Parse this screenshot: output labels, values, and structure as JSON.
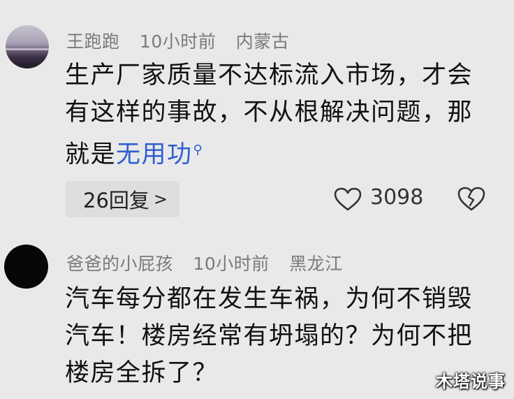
{
  "comments": [
    {
      "username": "王跑跑",
      "time": "10小时前",
      "location": "内蒙古",
      "text_main": "生产厂家质量不达标流入市场，才会有这样的事故，不从根解决问题，那就是",
      "text_link": "无用功",
      "replies_label": "26回复",
      "likes": "3098"
    },
    {
      "username": "爸爸的小屁孩",
      "time": "10小时前",
      "location": "黑龙江",
      "text_main": "汽车每分都在发生车祸，为何不销毁汽车！楼房经常有坍塌的？为何不把楼房全拆了？"
    }
  ],
  "watermark": "木塔说事",
  "icons": {
    "search": "search-icon",
    "chevron": "chevron-right-icon",
    "like": "heart-icon",
    "dislike": "broken-heart-icon"
  },
  "colors": {
    "background": "#e9e9e9",
    "link": "#2f5fd0",
    "meta": "#7a7a7a"
  }
}
